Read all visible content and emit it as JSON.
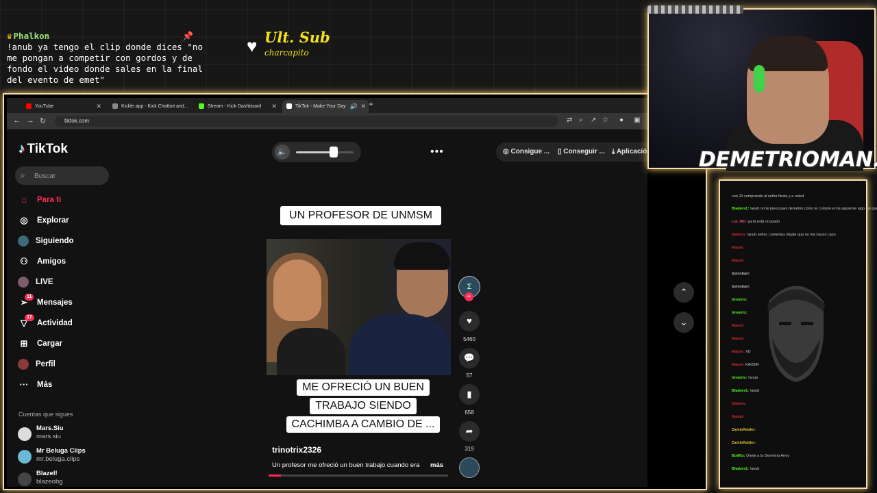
{
  "overlay": {
    "pinned": {
      "user": "Phalkon",
      "message": "!anub ya tengo el clip donde dices \"no me pongan a competir con gordos y de fondo el video donde sales en la final del evento de emet\""
    },
    "ult_sub": {
      "label": "Ult. Sub",
      "user": "charcapito"
    },
    "streamer_name": "DEMETRIOMAN...",
    "accent_color": "#f3deb0"
  },
  "browser": {
    "tabs": [
      {
        "label": "YouTube",
        "icon_color": "#ff0000",
        "active": false
      },
      {
        "label": "Kickle.app - Kick Chatbot and...",
        "icon_color": "#888888",
        "active": false
      },
      {
        "label": "Stream - Kick Dashboard",
        "icon_color": "#53fc18",
        "active": false
      },
      {
        "label": "TikTok - Make Your Day",
        "icon_color": "#ffffff",
        "active": true
      }
    ],
    "url": "tiktok.com"
  },
  "tiktok": {
    "logo": "TikTok",
    "search_placeholder": "Buscar",
    "nav": [
      {
        "label": "Para ti",
        "icon": "home-icon",
        "active": true
      },
      {
        "label": "Explorar",
        "icon": "compass-icon"
      },
      {
        "label": "Siguiendo",
        "icon": "following-avatar-icon"
      },
      {
        "label": "Amigos",
        "icon": "friends-icon"
      },
      {
        "label": "LIVE",
        "icon": "live-avatar-icon"
      },
      {
        "label": "Mensajes",
        "icon": "messages-icon",
        "badge": "11"
      },
      {
        "label": "Actividad",
        "icon": "activity-icon",
        "badge": "17"
      },
      {
        "label": "Cargar",
        "icon": "upload-icon"
      },
      {
        "label": "Perfil",
        "icon": "profile-avatar-icon"
      },
      {
        "label": "Más",
        "icon": "more-dots-icon"
      }
    ],
    "following_title": "Cuentas que sigues",
    "following": [
      {
        "name": "Mars.Siu",
        "handle": "mars.siu"
      },
      {
        "name": "Mr Beluga Clips",
        "handle": "mr.beluga.clips"
      },
      {
        "name": "Blazel!",
        "handle": "blazeobg"
      }
    ],
    "volume": 0.65,
    "top_buttons": [
      "Consigue ...",
      "Conseguir ...",
      "Aplicación"
    ],
    "video": {
      "caption_top": "UN PROFESOR DE UNMSM",
      "caption_bottom": [
        "ME OFRECIÓ UN BUEN",
        "TRABAJO SIENDO",
        "CACHIMBA A CAMBIO DE ..."
      ],
      "author": "trinotrix2326",
      "description": "Un profesor me ofreció un buen trabajo cuando era",
      "more_label": "más",
      "progress": 0.07
    },
    "actions": {
      "likes": "5460",
      "comments": "57",
      "saves": "658",
      "shares": "319"
    }
  }
}
